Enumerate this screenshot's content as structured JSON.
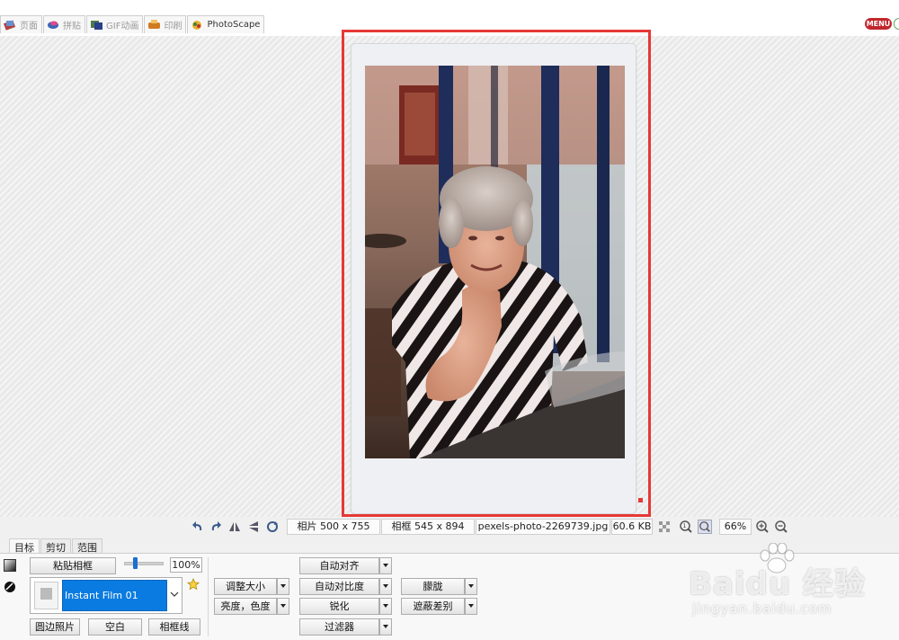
{
  "top_tabs": [
    {
      "label": "页面",
      "icon": "page-icon",
      "active": false
    },
    {
      "label": "拼贴",
      "icon": "combine-icon",
      "active": false
    },
    {
      "label": "GIF动画",
      "icon": "gif-icon",
      "active": false
    },
    {
      "label": "印刷",
      "icon": "print-icon",
      "active": false
    },
    {
      "label": "PhotoScape",
      "icon": "photoscape-icon",
      "active": true
    }
  ],
  "menu_label": "MENU",
  "status": {
    "photo_size": "相片 500 x 755",
    "frame_size": "相框 545 x 894",
    "filename": "pexels-photo-2269739.jpg",
    "filesize": "60.6 KB",
    "zoom": "66%"
  },
  "panel": {
    "tabs": [
      "目标",
      "剪切",
      "范围"
    ],
    "paste_frame": "粘贴相框",
    "opacity_pct": "100%",
    "opacity_value": 0.28,
    "frame_name": "Instant Film 01",
    "round_photo": "圆边照片",
    "blank": "空白",
    "frame_line": "相框线",
    "resize": "调整大小",
    "brightness": "亮度，色度",
    "auto_level": "自动对齐",
    "auto_contrast": "自动对比度",
    "sharpen": "锐化",
    "filter": "过滤器",
    "blur": "朦胧",
    "backlight": "遮蔽差别"
  },
  "watermark": {
    "main": "Baidu 经验",
    "sub": "jingyan.baidu.com"
  },
  "colors": {
    "accent": "#0a7be0",
    "selection": "#e53935",
    "menu": "#c0272d"
  }
}
